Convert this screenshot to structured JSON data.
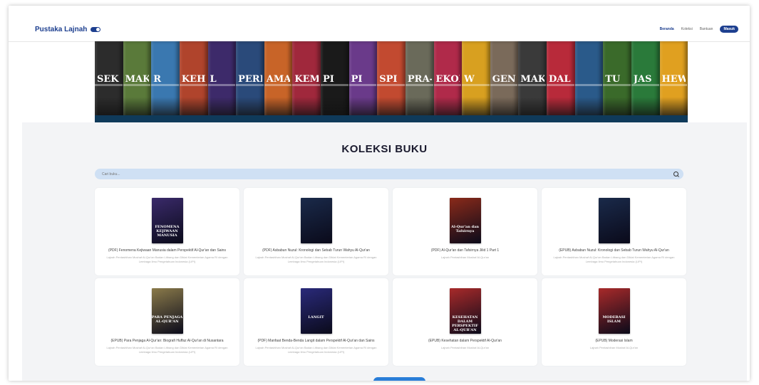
{
  "header": {
    "brand": "Pustaka Lajnah",
    "menu": [
      {
        "label": "Beranda",
        "active": true
      },
      {
        "label": "Koleksi",
        "active": false
      },
      {
        "label": "Bantuan",
        "active": false
      }
    ],
    "login_label": "Masuk"
  },
  "banner": {
    "books": [
      {
        "title": "SEK",
        "color": "#2c2c2c"
      },
      {
        "title": "MAKA",
        "color": "#5a7a3a"
      },
      {
        "title": "R",
        "color": "#3a78b0"
      },
      {
        "title": "KEH",
        "color": "#b0442c"
      },
      {
        "title": "L",
        "color": "#3d2a6a"
      },
      {
        "title": "PERI",
        "color": "#2a4a7a"
      },
      {
        "title": "AMAT",
        "color": "#c86428"
      },
      {
        "title": "KEME",
        "color": "#a0283c"
      },
      {
        "title": "PI",
        "color": "#1a1a1a"
      },
      {
        "title": "PI",
        "color": "#6a3a8a"
      },
      {
        "title": "SPI",
        "color": "#c24a30"
      },
      {
        "title": "PRA-",
        "color": "#6a6a5a"
      },
      {
        "title": "EKON",
        "color": "#b02a4a"
      },
      {
        "title": "W",
        "color": "#d8a020"
      },
      {
        "title": "GEN",
        "color": "#7a6a5a"
      },
      {
        "title": "MAKI",
        "color": "#3a3a3a"
      },
      {
        "title": "DAL",
        "color": "#b82a3a"
      },
      {
        "title": "",
        "color": "#2a5a8a"
      },
      {
        "title": "TU",
        "color": "#3a6a2a"
      },
      {
        "title": "JAS",
        "color": "#2a7a3a"
      },
      {
        "title": "HEWAN",
        "color": "#e0a020"
      }
    ]
  },
  "collection": {
    "title": "KOLEKSI BUKU",
    "search_placeholder": "Cari buku...",
    "books": [
      {
        "title": "(PDF) Fenomena Kejiwaan Manusia dalam Perspektif Al-Qur'an dan Sains",
        "author": "Lajnah Pentashihan Mushaf Al-Qur'an Badan Litbang dan Diklat Kementerian Agama RI dengan Lembaga Ilmu Pengetahuan Indonesia (LIPI)",
        "cover_color": "#3a2a6a",
        "cover_text": "FENOMENA KEJIWAAN MANUSIA"
      },
      {
        "title": "(PDF) Asbabun Nuzul: Kronologi dan Sebab Turun Wahyu Al-Qur'an",
        "author": "Lajnah Pentashihan Mushaf Al-Qur'an Badan Litbang dan Diklat Kementerian Agama RI dengan Lembaga Ilmu Pengetahuan Indonesia (LIPI)",
        "cover_color": "#1a2a4a",
        "cover_text": ""
      },
      {
        "title": "(PDF) Al-Qur'an dan Tafsirnya Jilid 1 Part 1",
        "author": "Lajnah Pentashihan Mushaf Al-Qur'an",
        "cover_color": "#8a2a1a",
        "cover_text": "Al-Qur'an dan Tafsirnya"
      },
      {
        "title": "(EPUB) Asbabun Nuzul: Kronologi dan Sebab Turun Wahyu Al-Qur'an",
        "author": "Lajnah Pentashihan Mushaf Al-Qur'an Badan Litbang dan Diklat Kementerian Agama RI dengan Lembaga Ilmu Pengetahuan Indonesia (LIPI)",
        "cover_color": "#1a2a4a",
        "cover_text": ""
      },
      {
        "title": "(EPUB) Para Penjaga Al-Qur'an: Biografi Huffaz Al-Qur'an di Nusantara",
        "author": "Lajnah Pentashihan Mushaf Al-Qur'an Badan Litbang dan Diklat Kementerian Agama RI dengan Lembaga Ilmu Pengetahuan Indonesia (LIPI)",
        "cover_color": "#8a7a4a",
        "cover_text": "PARA PENJAGA AL-QUR'AN"
      },
      {
        "title": "(PDF) Manfaat Benda-Benda Langit dalam Perspektif Al-Qur'an dan Sains",
        "author": "Lajnah Pentashihan Mushaf Al-Qur'an Badan Litbang dan Diklat Kementerian Agama RI dengan Lembaga Ilmu Pengetahuan Indonesia (LIPI)",
        "cover_color": "#2a2a7a",
        "cover_text": "LANGIT"
      },
      {
        "title": "(EPUB) Kesehatan dalam Perspektif Al-Qur'an",
        "author": "Lajnah Pentashihan Mushaf Al-Qur'an",
        "cover_color": "#a82a2a",
        "cover_text": "KESEHATAN DALAM PERSPEKTIF AL-QUR'AN"
      },
      {
        "title": "(EPUB) Moderasi Islam",
        "author": "Lajnah Pentashihan Mushaf Al-Qur'an",
        "cover_color": "#a82a2a",
        "cover_text": "MODERASI ISLAM"
      }
    ]
  }
}
